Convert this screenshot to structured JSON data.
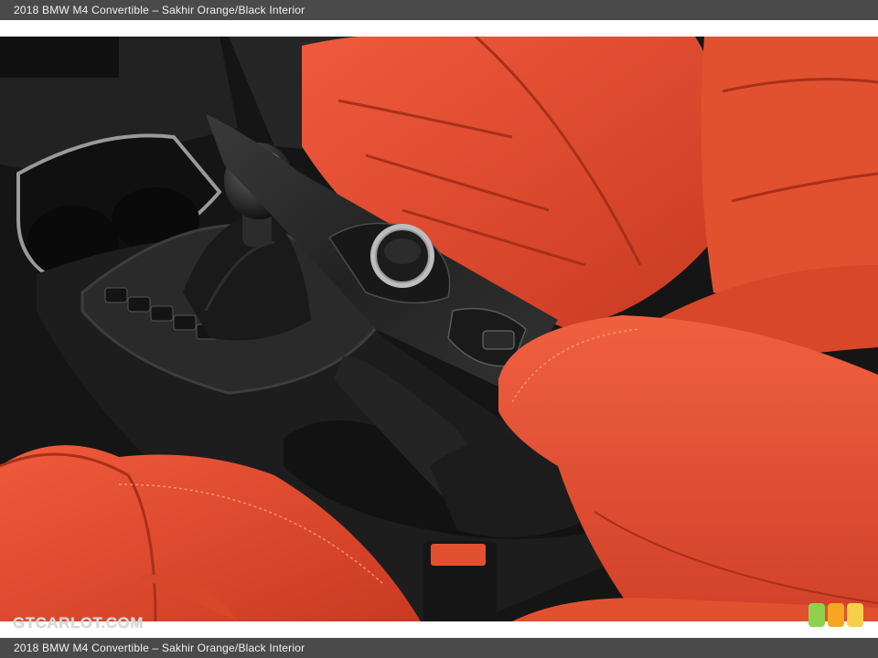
{
  "caption_top": "2018 BMW M4 Convertible – Sakhir Orange/Black Interior",
  "caption_bottom": "2018 BMW M4 Convertible – Sakhir Orange/Black Interior",
  "watermark": "GTCARLOT.COM",
  "colors": {
    "leather": "#e0482c",
    "leather_dark": "#b8321c",
    "trim": "#1c1c1c",
    "bar": "#4a4a4a"
  },
  "logo_colors": [
    "#8fd14f",
    "#f5a623",
    "#f7d04a"
  ]
}
